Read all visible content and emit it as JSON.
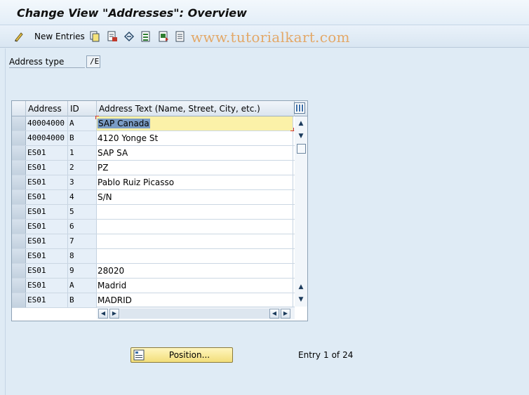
{
  "window": {
    "title": "Change View \"Addresses\": Overview"
  },
  "toolbar": {
    "new_entries_label": "New Entries",
    "watermark": "www.tutorialkart.com",
    "icons": [
      "pencil-glasses-icon",
      "copy-icon",
      "delete-icon",
      "undo-icon",
      "select-all-icon",
      "select-block-icon",
      "deselect-all-icon"
    ]
  },
  "address_type": {
    "label": "Address type",
    "value": "/E"
  },
  "table": {
    "headers": {
      "address": "Address",
      "id": "ID",
      "text": "Address Text (Name, Street, City, etc.)"
    },
    "rows": [
      {
        "address": "40004000",
        "id": "A",
        "text": "SAP Canada"
      },
      {
        "address": "40004000",
        "id": "B",
        "text": "4120 Yonge St"
      },
      {
        "address": "ES01",
        "id": "1",
        "text": "SAP SA"
      },
      {
        "address": "ES01",
        "id": "2",
        "text": "PZ"
      },
      {
        "address": "ES01",
        "id": "3",
        "text": "Pablo Ruiz Picasso"
      },
      {
        "address": "ES01",
        "id": "4",
        "text": "S/N"
      },
      {
        "address": "ES01",
        "id": "5",
        "text": ""
      },
      {
        "address": "ES01",
        "id": "6",
        "text": ""
      },
      {
        "address": "ES01",
        "id": "7",
        "text": ""
      },
      {
        "address": "ES01",
        "id": "8",
        "text": ""
      },
      {
        "address": "ES01",
        "id": "9",
        "text": "28020"
      },
      {
        "address": "ES01",
        "id": "A",
        "text": "Madrid"
      },
      {
        "address": "ES01",
        "id": "B",
        "text": "MADRID"
      }
    ]
  },
  "position_button": {
    "label": "Position..."
  },
  "entry_status": {
    "entry": "Entry",
    "current": "1",
    "of": "of",
    "total": "24"
  },
  "colors": {
    "background": "#dfebf5",
    "highlight": "#fbf1a8",
    "button": "#f2de7a",
    "watermark": "#e3a868"
  }
}
